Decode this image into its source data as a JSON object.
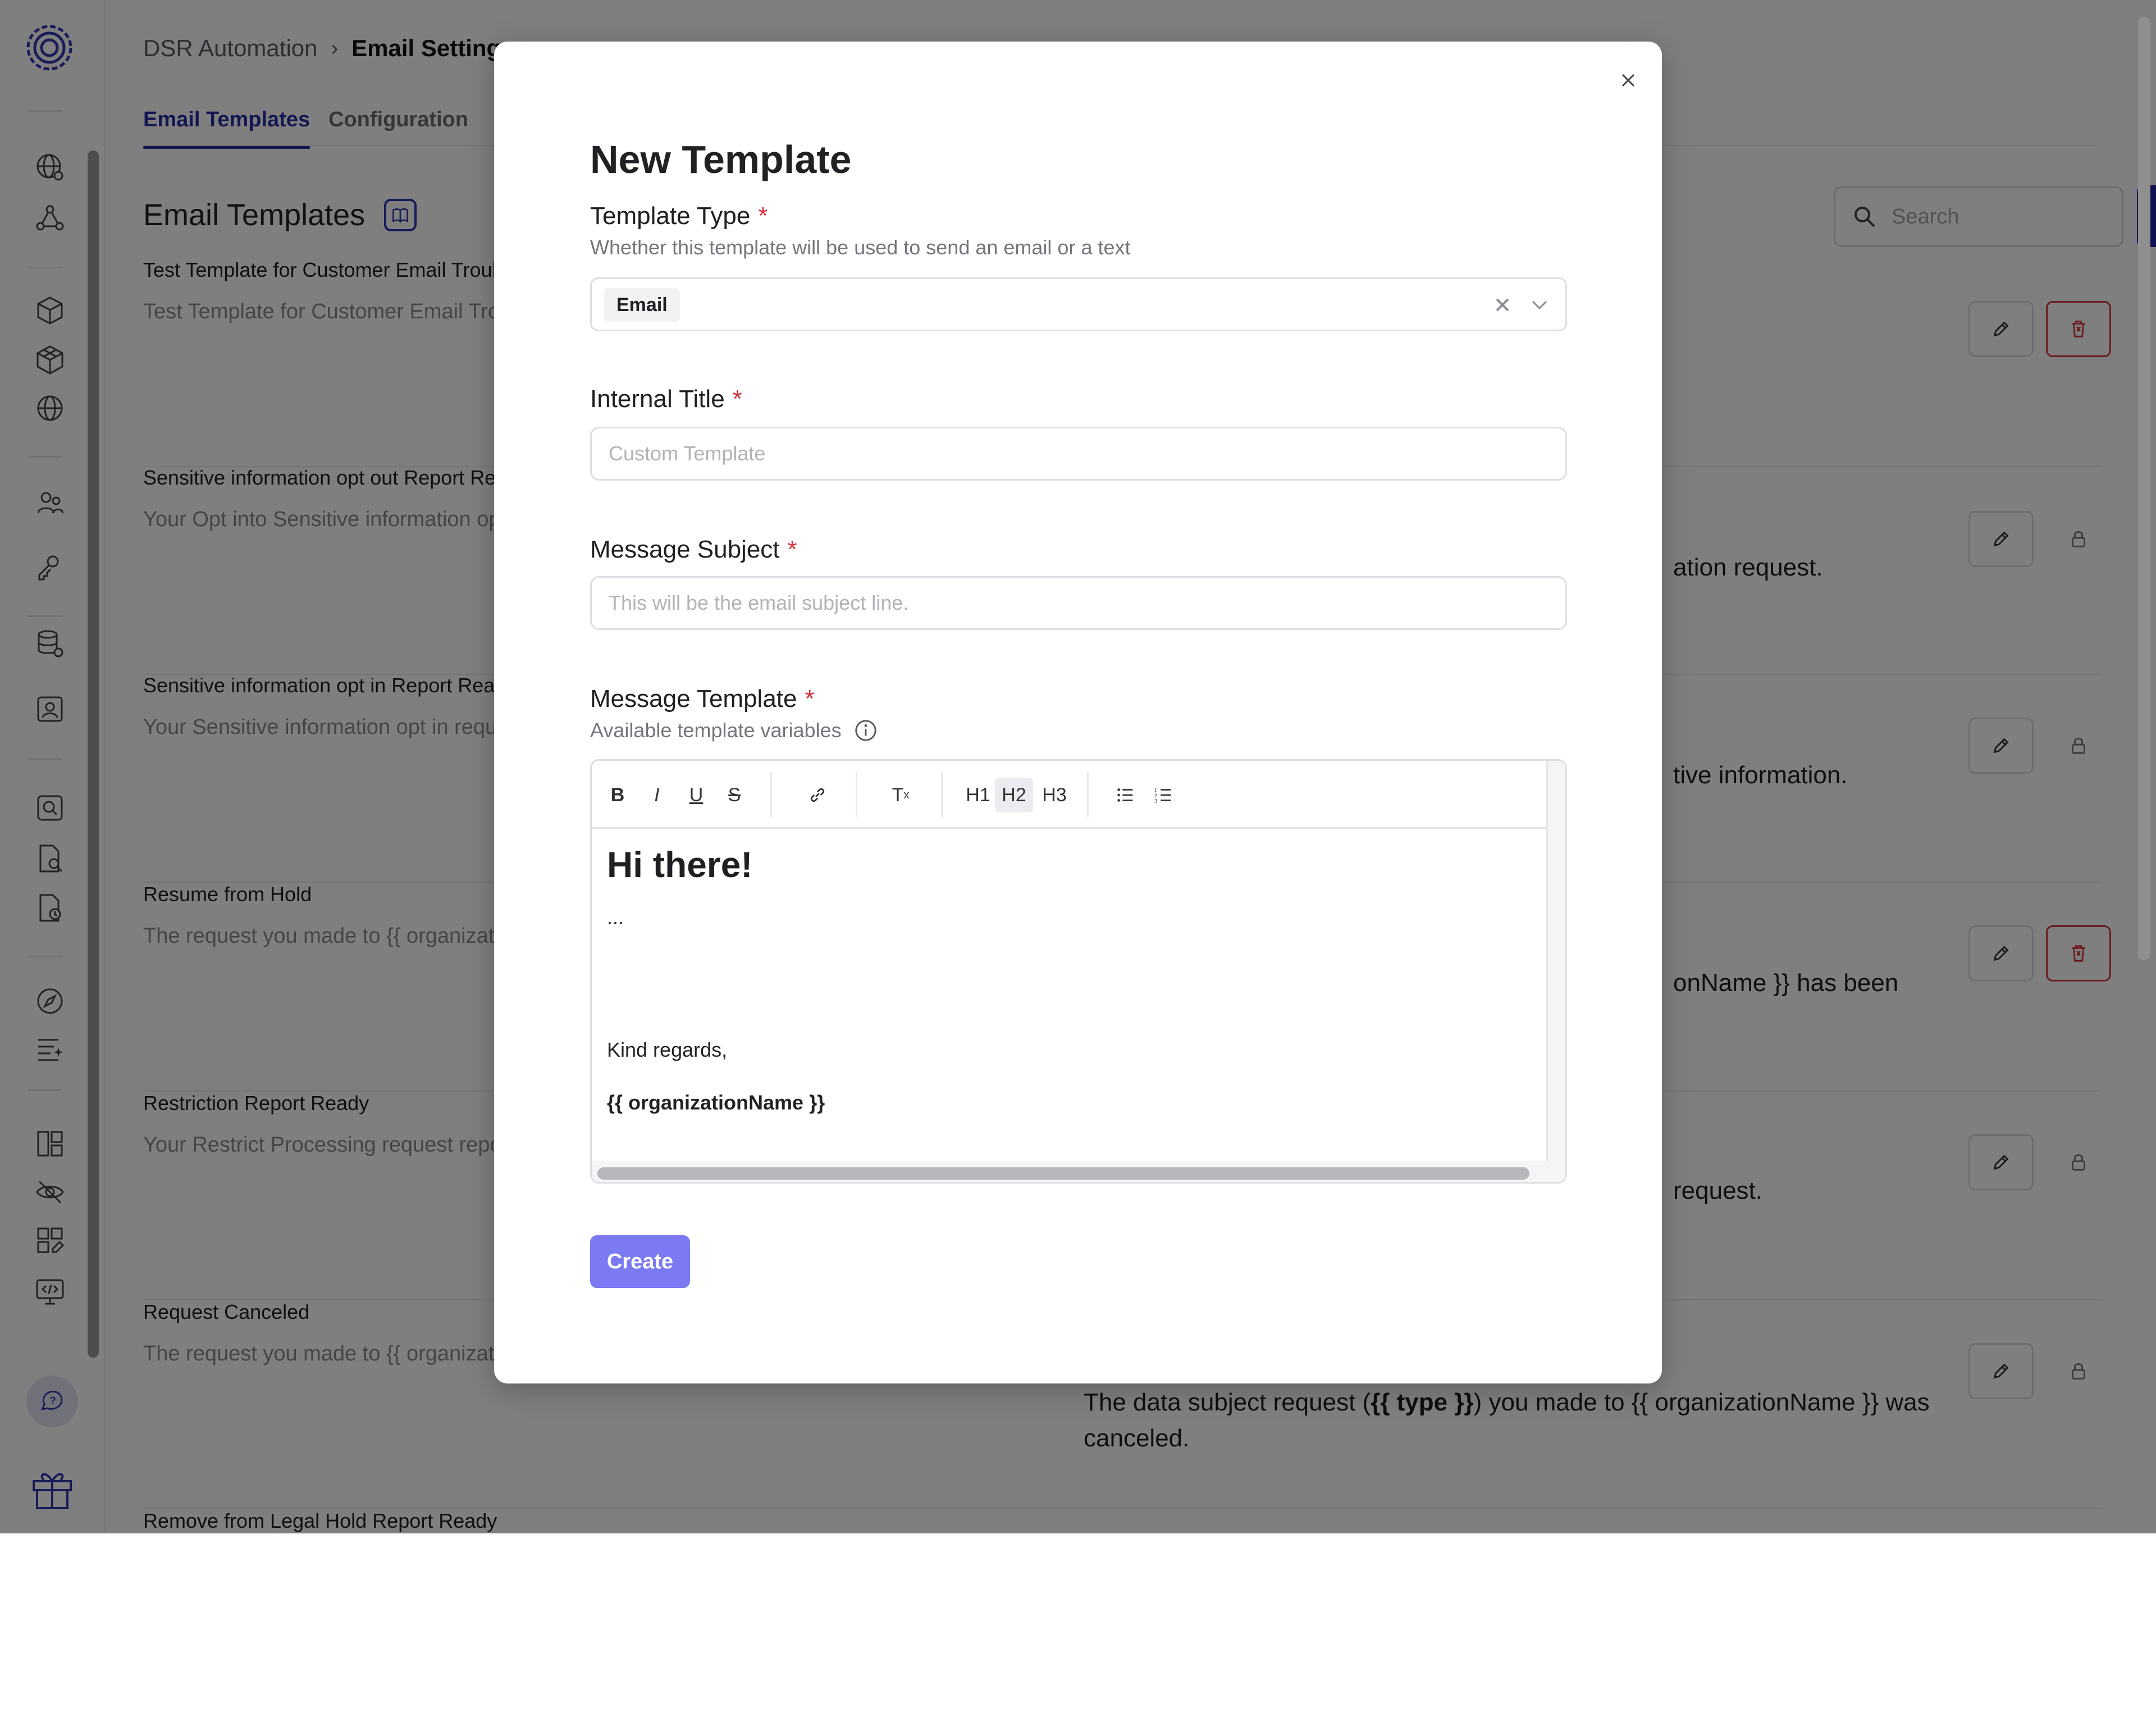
{
  "breadcrumb": {
    "parent": "DSR Automation",
    "current": "Email Settings"
  },
  "tabs": [
    {
      "label": "Email Templates",
      "active": true
    },
    {
      "label": "Configuration",
      "active": false
    }
  ],
  "section": {
    "title": "Email Templates",
    "icon": "book-icon"
  },
  "search": {
    "placeholder": "Search"
  },
  "add_button": {
    "label": "+"
  },
  "templates": [
    {
      "name": "Test Template for Customer Email Troub",
      "preview": "Test Template for Customer Email Troub",
      "right": "",
      "deletable": true
    },
    {
      "name": "Sensitive information opt out Report Rea",
      "preview": "Your Opt into Sensitive information opt o",
      "right": "ation request.",
      "deletable": false
    },
    {
      "name": "Sensitive information opt in Report Read",
      "preview": "Your Sensitive information opt in request",
      "right": "tive information.",
      "deletable": false
    },
    {
      "name": "Resume from Hold",
      "preview": "The request you made to {{ organizationN",
      "right": "onName }} has been",
      "deletable": true
    },
    {
      "name": "Restriction Report Ready",
      "preview": "Your Restrict Processing request report i",
      "right": "request.",
      "deletable": false
    },
    {
      "name": "Request Canceled",
      "preview": "The request you made to {{ organizationN",
      "right": "",
      "deletable": false
    },
    {
      "name": "Remove from Legal Hold Report Ready",
      "preview": "",
      "right": "",
      "deletable": false
    }
  ],
  "canceled_preview": {
    "prefix": "The data subject request (",
    "bold": "{{ type }}",
    "suffix": ") you made to {{ organizationName }} was",
    "line2": "canceled."
  },
  "modal": {
    "title": "New Template",
    "template_type": {
      "label": "Template Type",
      "required": "*",
      "help": "Whether this template will be used to send an email or a text",
      "value": "Email"
    },
    "internal_title": {
      "label": "Internal Title",
      "required": "*",
      "placeholder": "Custom Template"
    },
    "message_subject": {
      "label": "Message Subject",
      "required": "*",
      "placeholder": "This will be the email subject line."
    },
    "message_template": {
      "label": "Message Template",
      "required": "*",
      "help": "Available template variables",
      "toolbar": {
        "h1": "H1",
        "h2": "H2",
        "h3": "H3",
        "active": "H2"
      },
      "content": {
        "heading": "Hi there!",
        "ellipsis": "...",
        "closing": "Kind regards,",
        "signature": "{{ organizationName }}"
      }
    },
    "create_label": "Create"
  },
  "colors": {
    "accent": "#2326a3",
    "create": "#7b7af3",
    "danger": "#d9363e",
    "required": "#d2323a"
  }
}
